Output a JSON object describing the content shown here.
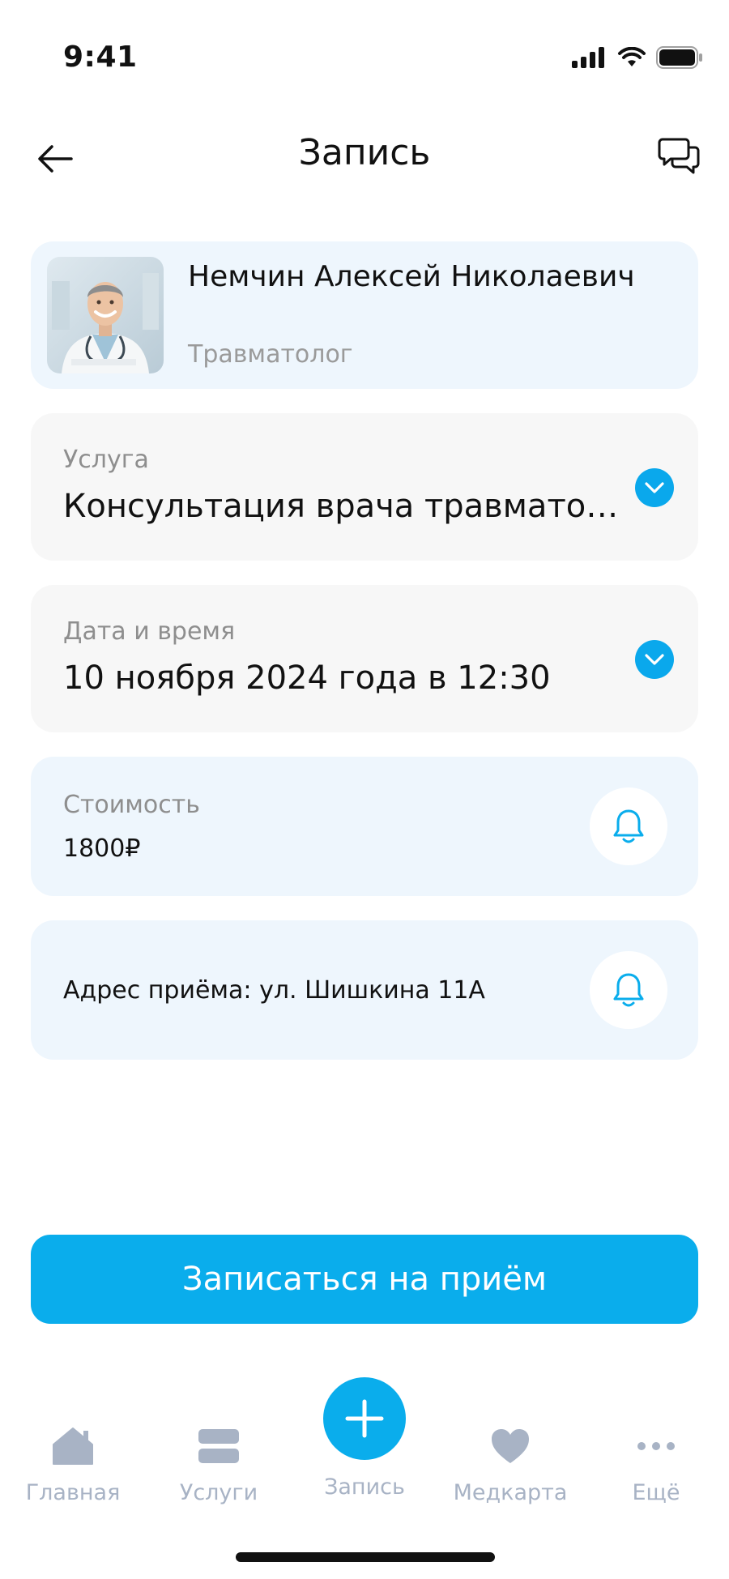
{
  "status_bar": {
    "time": "9:41"
  },
  "header": {
    "title": "Запись",
    "back_icon": "arrow-left-icon",
    "chat_icon": "chat-bubbles-icon"
  },
  "doctor": {
    "name": "Немчин Алексей Николаевич",
    "specialty": "Травматолог"
  },
  "service": {
    "label": "Услуга",
    "value": "Консультация врача травматолога"
  },
  "datetime": {
    "label": "Дата и время",
    "value": "10 ноября 2024 года в 12:30"
  },
  "price": {
    "label": "Стоимость",
    "value": "1800₽"
  },
  "address": {
    "text": "Адрес приёма: ул. Шишкина 11А"
  },
  "cta": {
    "label": "Записаться на приём"
  },
  "nav": {
    "home": "Главная",
    "services": "Услуги",
    "appointment": "Запись",
    "medcard": "Медкарта",
    "more": "Ещё"
  },
  "colors": {
    "accent": "#0aadec",
    "card_blue": "#eef6fd",
    "card_gray": "#f7f7f7",
    "nav_inactive": "#a8b3c5"
  }
}
